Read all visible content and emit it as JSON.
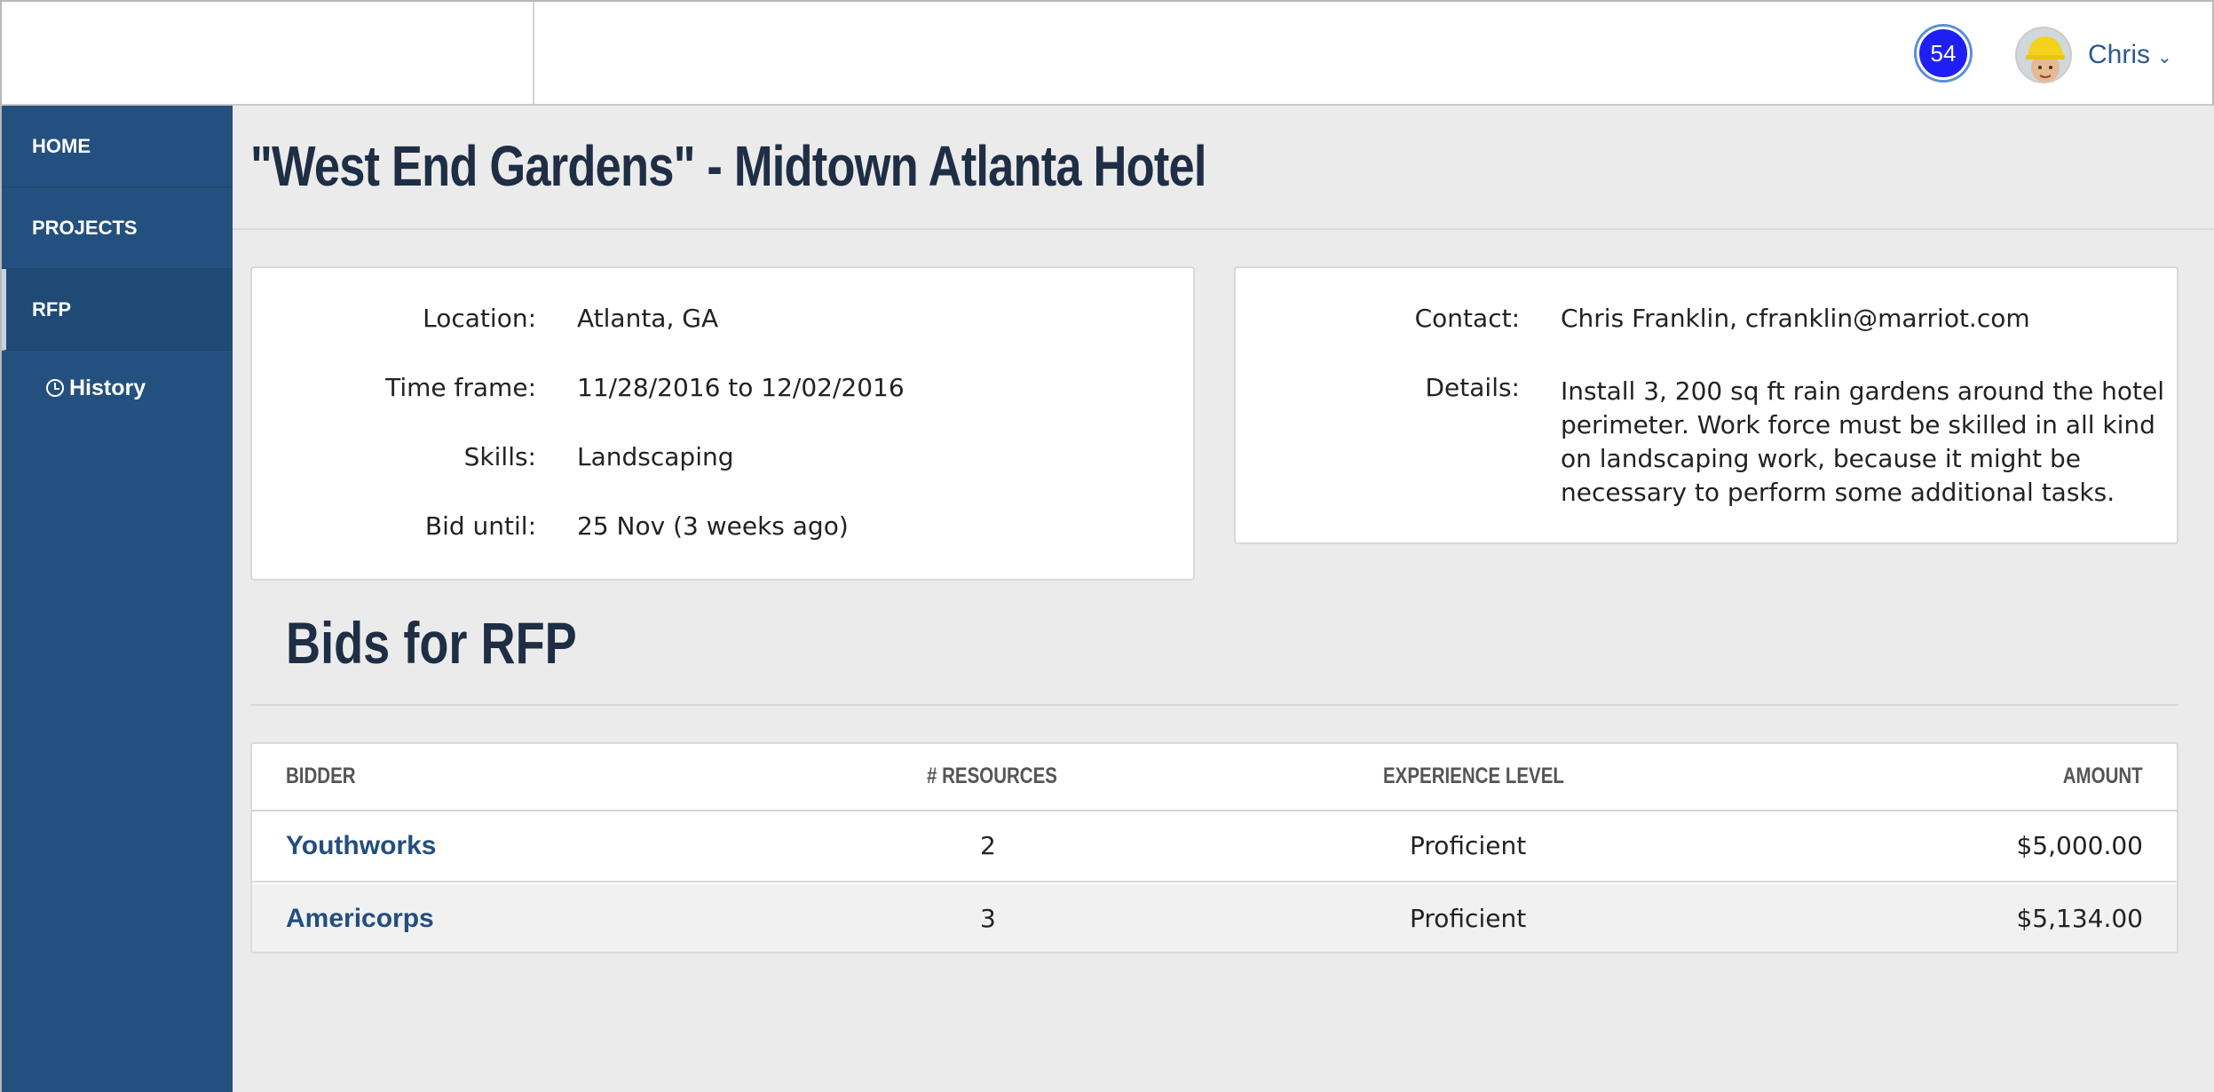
{
  "header": {
    "notification_count": "54",
    "user_name": "Chris"
  },
  "sidebar": {
    "items": [
      {
        "label": "HOME"
      },
      {
        "label": "PROJECTS"
      },
      {
        "label": "RFP"
      }
    ],
    "sub_items": [
      {
        "label": "History",
        "icon": "clock-icon"
      }
    ],
    "active": "RFP"
  },
  "page": {
    "title": "\"West End Gardens\" - Midtown Atlanta Hotel"
  },
  "details_left": {
    "location_label": "Location:",
    "location_value": "Atlanta, GA",
    "timeframe_label": "Time frame:",
    "timeframe_value": "11/28/2016 to 12/02/2016",
    "skills_label": "Skills:",
    "skills_value": "Landscaping",
    "bid_until_label": "Bid until:",
    "bid_until_value": "25 Nov (3 weeks ago)"
  },
  "details_right": {
    "contact_label": "Contact:",
    "contact_value": "Chris Franklin, cfranklin@marriot.com",
    "details_label": "Details:",
    "details_value": "Install 3, 200 sq ft rain gardens around the hotel perimeter. Work force must be skilled in all kind on landscaping work, because it might be necessary to perform some additional tasks."
  },
  "bids": {
    "title": "Bids for RFP",
    "columns": [
      "BIDDER",
      "# RESOURCES",
      "EXPERIENCE LEVEL",
      "AMOUNT"
    ],
    "rows": [
      {
        "bidder": "Youthworks",
        "resources": "2",
        "experience": "Proficient",
        "amount": "$5,000.00"
      },
      {
        "bidder": "Americorps",
        "resources": "3",
        "experience": "Proficient",
        "amount": "$5,134.00"
      }
    ]
  },
  "colors": {
    "sidebar": "#23507f",
    "accent_link": "#234e80",
    "badge": "#1f1ff5",
    "heading": "#1e2e45"
  }
}
